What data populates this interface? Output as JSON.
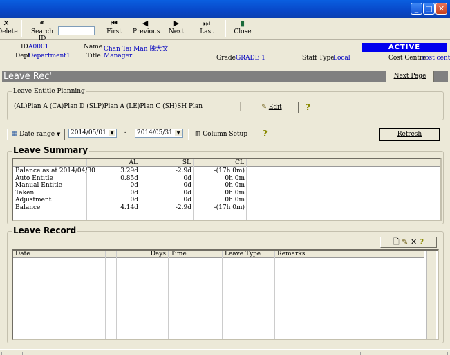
{
  "toolbar": {
    "delete": "Delete",
    "search_id": "Search ID",
    "search_value": "",
    "first": "First",
    "previous": "Previous",
    "next": "Next",
    "last": "Last",
    "close": "Close"
  },
  "employee": {
    "id_label": "ID",
    "id": "A0001",
    "dept_label": "Dept",
    "dept": "Department1",
    "name_label": "Name",
    "name": "Chan Tai Man 陳大文",
    "title_label": "Title",
    "title": "Manager",
    "grade_label": "Grade",
    "grade": "GRADE 1",
    "staff_type_label": "Staff Type",
    "staff_type": "Local",
    "status": "ACTIVE",
    "cost_centre_label": "Cost Centre",
    "cost_centre": "cost centre"
  },
  "panel": {
    "title": "Leave Rec'",
    "next_page": "Next Page"
  },
  "entitle": {
    "group_label": "Leave Entitle Planning",
    "plan_text": "(AL)Plan A (CA)Plan D (SLP)Plan A (LE)Plan C (SH)SH Plan",
    "edit": "Edit"
  },
  "filter": {
    "date_range": "Date range",
    "from": "2014/05/01",
    "dash": "-",
    "to": "2014/05/31",
    "column_setup": "Column Setup",
    "refresh": "Refresh"
  },
  "summary": {
    "title": "Leave Summary",
    "columns": [
      "",
      "AL",
      "SL",
      "CL"
    ],
    "rows": [
      [
        "Balance as at 2014/04/30",
        "3.29d",
        "-2.9d",
        "-(17h  0m)"
      ],
      [
        "Auto Entitle",
        "0.85d",
        "0d",
        "0h  0m"
      ],
      [
        "Manual Entitle",
        "0d",
        "0d",
        "0h  0m"
      ],
      [
        "Taken",
        "0d",
        "0d",
        "0h  0m"
      ],
      [
        "Adjustment",
        "0d",
        "0d",
        "0h  0m"
      ],
      [
        "Balance",
        "4.14d",
        "-2.9d",
        "-(17h  0m)"
      ]
    ]
  },
  "record": {
    "title": "Leave Record",
    "columns": [
      "Date",
      "",
      "Days",
      "Time",
      "Leave Type",
      "Remarks"
    ]
  },
  "colors": {
    "title_bar": "#0A5FE0",
    "active_badge": "#0000EE",
    "link_text": "#0000C0",
    "band": "#808080"
  }
}
